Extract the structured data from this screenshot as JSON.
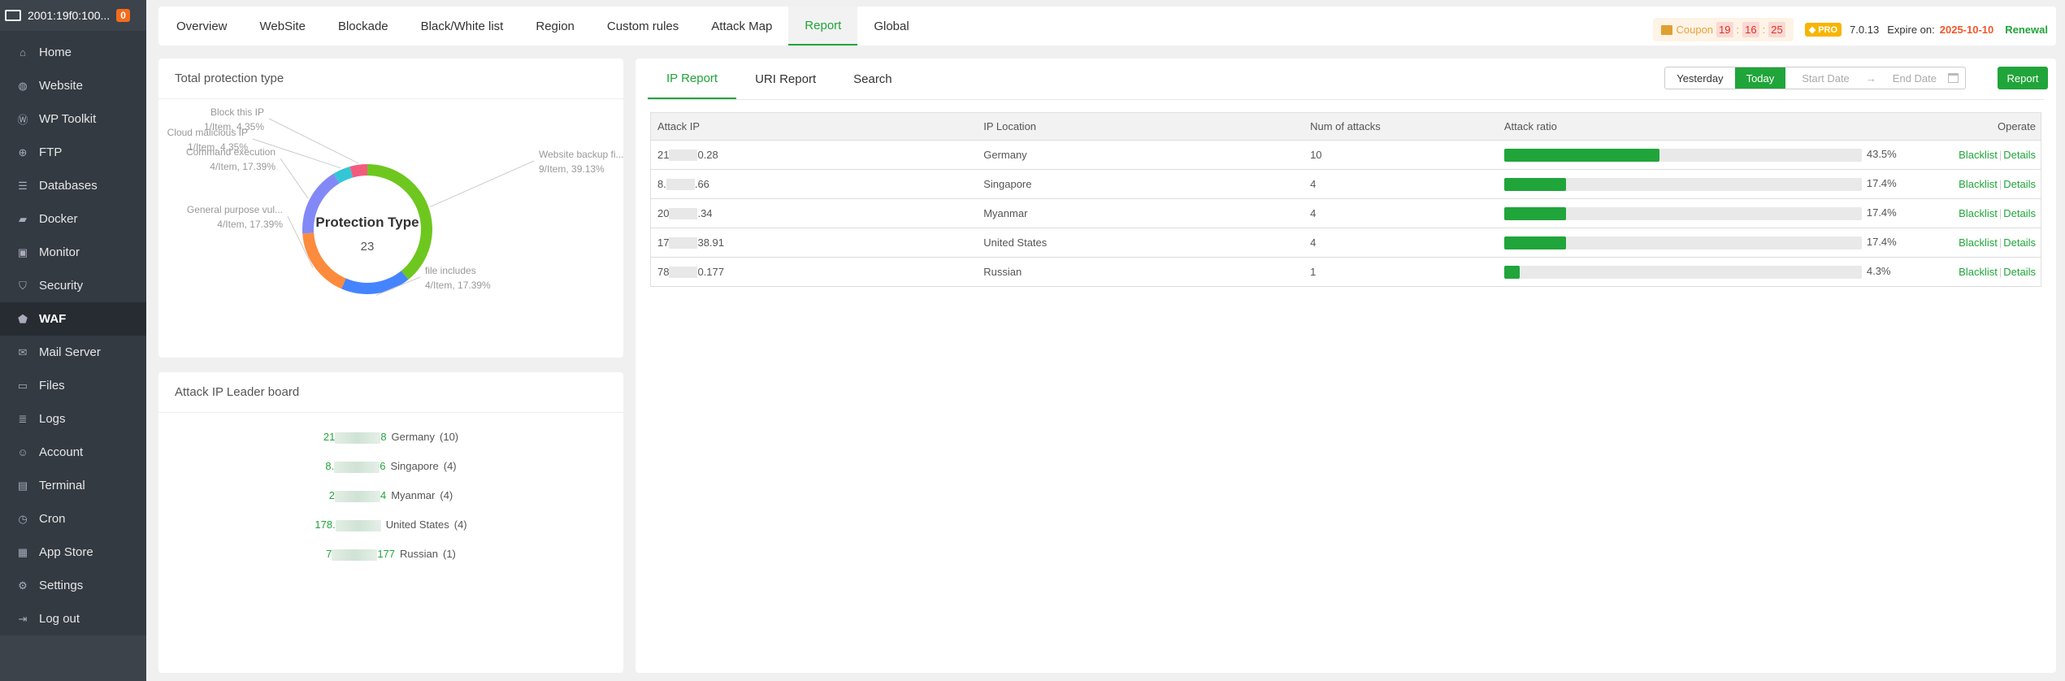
{
  "sidebar": {
    "server": "2001:19f0:100...",
    "badge": "0",
    "items": [
      {
        "label": "Home",
        "icon": "home-icon"
      },
      {
        "label": "Website",
        "icon": "globe-icon"
      },
      {
        "label": "WP Toolkit",
        "icon": "wordpress-icon"
      },
      {
        "label": "FTP",
        "icon": "ftp-icon"
      },
      {
        "label": "Databases",
        "icon": "database-icon"
      },
      {
        "label": "Docker",
        "icon": "docker-icon"
      },
      {
        "label": "Monitor",
        "icon": "monitor-icon"
      },
      {
        "label": "Security",
        "icon": "shield-icon"
      },
      {
        "label": "WAF",
        "icon": "waf-icon",
        "active": true
      },
      {
        "label": "Mail Server",
        "icon": "mail-icon"
      },
      {
        "label": "Files",
        "icon": "folder-icon"
      },
      {
        "label": "Logs",
        "icon": "logs-icon"
      },
      {
        "label": "Account",
        "icon": "user-icon"
      },
      {
        "label": "Terminal",
        "icon": "terminal-icon"
      },
      {
        "label": "Cron",
        "icon": "clock-icon"
      },
      {
        "label": "App Store",
        "icon": "grid-icon"
      },
      {
        "label": "Settings",
        "icon": "gear-icon"
      },
      {
        "label": "Log out",
        "icon": "logout-icon"
      }
    ]
  },
  "tabs": [
    "Overview",
    "WebSite",
    "Blockade",
    "Black/White list",
    "Region",
    "Custom rules",
    "Attack Map",
    "Report",
    "Global"
  ],
  "active_tab": "Report",
  "topbar": {
    "coupon": "Coupon",
    "h": "19",
    "m": "16",
    "s": "25",
    "colon": ":",
    "pro": "PRO",
    "version": "7.0.13",
    "expire_label": "Expire on:",
    "expire_date": "2025-10-10",
    "renewal": "Renewal"
  },
  "protection": {
    "title": "Total protection type",
    "center_title": "Protection Type",
    "total": "23"
  },
  "chart_data": {
    "type": "pie",
    "title": "Protection Type",
    "total": 23,
    "slices": [
      {
        "name": "Website backup fi...",
        "count": 9,
        "label": "9/Item, 39.13%",
        "percent": 39.13,
        "color": "#6ec71e"
      },
      {
        "name": "file includes",
        "count": 4,
        "label": "4/Item, 17.39%",
        "percent": 17.39,
        "color": "#4584ff"
      },
      {
        "name": "General purpose vul...",
        "count": 4,
        "label": "4/Item, 17.39%",
        "percent": 17.39,
        "color": "#fd8b3d"
      },
      {
        "name": "Command execution",
        "count": 4,
        "label": "4/Item, 17.39%",
        "percent": 17.39,
        "color": "#8289f6"
      },
      {
        "name": "Cloud malicious IP",
        "count": 1,
        "label": "1/Item, 4.35%",
        "percent": 4.35,
        "color": "#34c6d6"
      },
      {
        "name": "Block this IP",
        "count": 1,
        "label": "1/Item, 4.35%",
        "percent": 4.35,
        "color": "#f35b7d"
      }
    ]
  },
  "leaderboard": {
    "title": "Attack IP Leader board",
    "items": [
      {
        "ip_start": "21",
        "ip_end": "8",
        "location": "Germany",
        "count": "(10)"
      },
      {
        "ip_start": "8.",
        "ip_end": "6",
        "location": "Singapore",
        "count": "(4)"
      },
      {
        "ip_start": "2",
        "ip_end": "4",
        "location": "Myanmar",
        "count": "(4)"
      },
      {
        "ip_start": "178.",
        "ip_end": "",
        "location": "United States",
        "count": "(4)"
      },
      {
        "ip_start": "7",
        "ip_end": "177",
        "location": "Russian",
        "count": "(1)"
      }
    ]
  },
  "report": {
    "tabs": [
      "IP Report",
      "URI Report",
      "Search"
    ],
    "yesterday": "Yesterday",
    "today": "Today",
    "start_placeholder": "Start Date",
    "end_placeholder": "End Date",
    "arrow": "→",
    "report_btn": "Report",
    "columns": [
      "Attack IP",
      "IP Location",
      "Num of attacks",
      "Attack ratio",
      "Operate"
    ],
    "rows": [
      {
        "ip_start": "21",
        "ip_end": "0.28",
        "location": "Germany",
        "num": "10",
        "ratio": 43.5,
        "ratio_label": "43.5%"
      },
      {
        "ip_start": "8.",
        "ip_end": ".66",
        "location": "Singapore",
        "num": "4",
        "ratio": 17.4,
        "ratio_label": "17.4%"
      },
      {
        "ip_start": "20",
        "ip_end": ".34",
        "location": "Myanmar",
        "num": "4",
        "ratio": 17.4,
        "ratio_label": "17.4%"
      },
      {
        "ip_start": "17",
        "ip_end": "38.91",
        "location": "United States",
        "num": "4",
        "ratio": 17.4,
        "ratio_label": "17.4%"
      },
      {
        "ip_start": "78",
        "ip_end": "0.177",
        "location": "Russian",
        "num": "1",
        "ratio": 4.3,
        "ratio_label": "4.3%"
      }
    ],
    "blacklist": "Blacklist",
    "details": "Details",
    "sep": "|"
  }
}
